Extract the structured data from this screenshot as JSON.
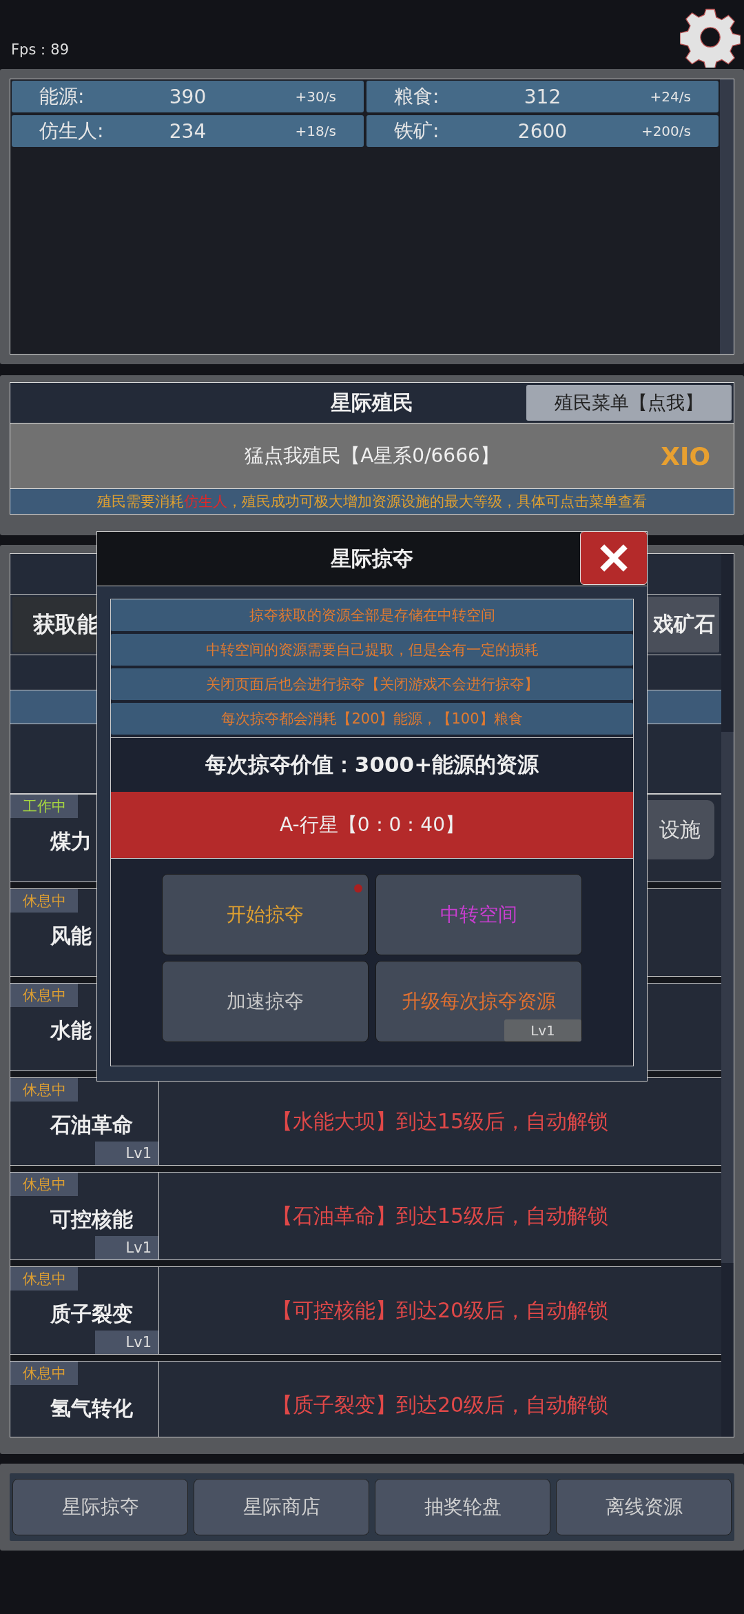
{
  "fps": "Fps：89",
  "resources": [
    {
      "name": "能源:",
      "value": "390",
      "rate": "+30/s"
    },
    {
      "name": "粮食:",
      "value": "312",
      "rate": "+24/s"
    },
    {
      "name": "仿生人:",
      "value": "234",
      "rate": "+18/s"
    },
    {
      "name": "铁矿:",
      "value": "2600",
      "rate": "+200/s"
    }
  ],
  "colonize": {
    "title": "星际殖民",
    "menu_button": "殖民菜单【点我】",
    "action": "猛点我殖民【A星系0/6666】",
    "tag": "XIO",
    "note": [
      {
        "text": "殖民需要消耗",
        "highlight": false
      },
      {
        "text": "仿生人",
        "highlight": true
      },
      {
        "text": "，殖民成功可极大增加资源设施的最大等级，具体可点击菜单查看",
        "highlight": false
      }
    ]
  },
  "facility_tabs": [
    "获取能",
    "戏矿石"
  ],
  "facilities": [
    {
      "status": "工作中",
      "working": true,
      "name": "煤力",
      "action": "设施"
    },
    {
      "status": "休息中",
      "working": false,
      "name": "风能"
    },
    {
      "status": "休息中",
      "working": false,
      "name": "水能"
    },
    {
      "status": "休息中",
      "working": false,
      "name": "石油革命",
      "lv": "Lv1",
      "note": "【水能大坝】到达15级后，自动解锁"
    },
    {
      "status": "休息中",
      "working": false,
      "name": "可控核能",
      "lv": "Lv1",
      "note": "【石油革命】到达15级后，自动解锁"
    },
    {
      "status": "休息中",
      "working": false,
      "name": "质子裂变",
      "lv": "Lv1",
      "note": "【可控核能】到达20级后，自动解锁"
    },
    {
      "status": "休息中",
      "working": false,
      "name": "氢气转化",
      "note": "【质子裂变】到达20级后，自动解锁"
    }
  ],
  "raid_dialog": {
    "title": "星际掠夺",
    "info": [
      "掠夺获取的资源全部是存储在中转空间",
      "中转空间的资源需要自己提取，但是会有一定的损耗",
      "关闭页面后也会进行掠夺【关闭游戏不会进行掠夺】",
      "每次掠夺都会消耗【200】能源，【100】粮食"
    ],
    "value_line": "每次掠夺价值：3000+能源的资源",
    "target": "A-行星【0：0：40】",
    "buttons": [
      {
        "label": "开始掠夺",
        "color": "#e0a030",
        "badge": true
      },
      {
        "label": "中转空间",
        "color": "#c83ed0",
        "badge": false
      },
      {
        "label": "加速掠夺",
        "color": "#c8c8c8",
        "badge": false
      },
      {
        "label": "升级每次掠夺资源",
        "color": "#e07030",
        "badge": false,
        "lv": "Lv1"
      }
    ]
  },
  "bottom_nav": [
    "星际掠夺",
    "星际商店",
    "抽奖轮盘",
    "离线资源"
  ]
}
